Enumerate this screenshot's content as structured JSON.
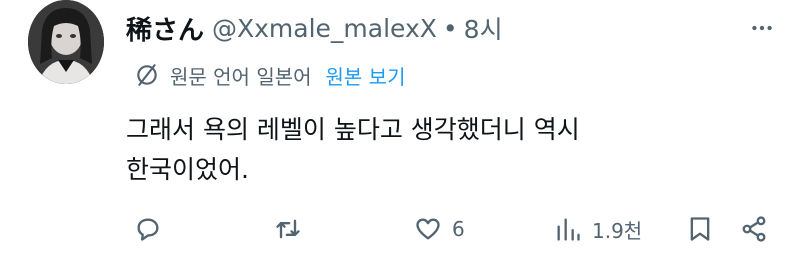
{
  "tweet": {
    "display_name": "稀さん",
    "handle": "@Xxmale_malexX",
    "separator": "•",
    "time": "8시",
    "translation_note": "원문 언어 일본어",
    "show_original": "원본 보기",
    "text_lines": [
      "그래서 욕의 레벨이 높다고 생각했더니 역시",
      "한국이었어."
    ],
    "actions": {
      "reply_count": "",
      "retweet_count": "",
      "like_count": "6",
      "views_count": "1.9천"
    }
  },
  "icons": {
    "more": "more-icon",
    "translate_off": "globe-off-icon",
    "reply": "reply-icon",
    "retweet": "retweet-icon",
    "like": "heart-icon",
    "views": "views-icon",
    "bookmark": "bookmark-icon",
    "share": "share-icon"
  },
  "colors": {
    "text": "#0f1419",
    "secondary": "#536471",
    "link": "#1d9bf0",
    "background": "#ffffff"
  }
}
